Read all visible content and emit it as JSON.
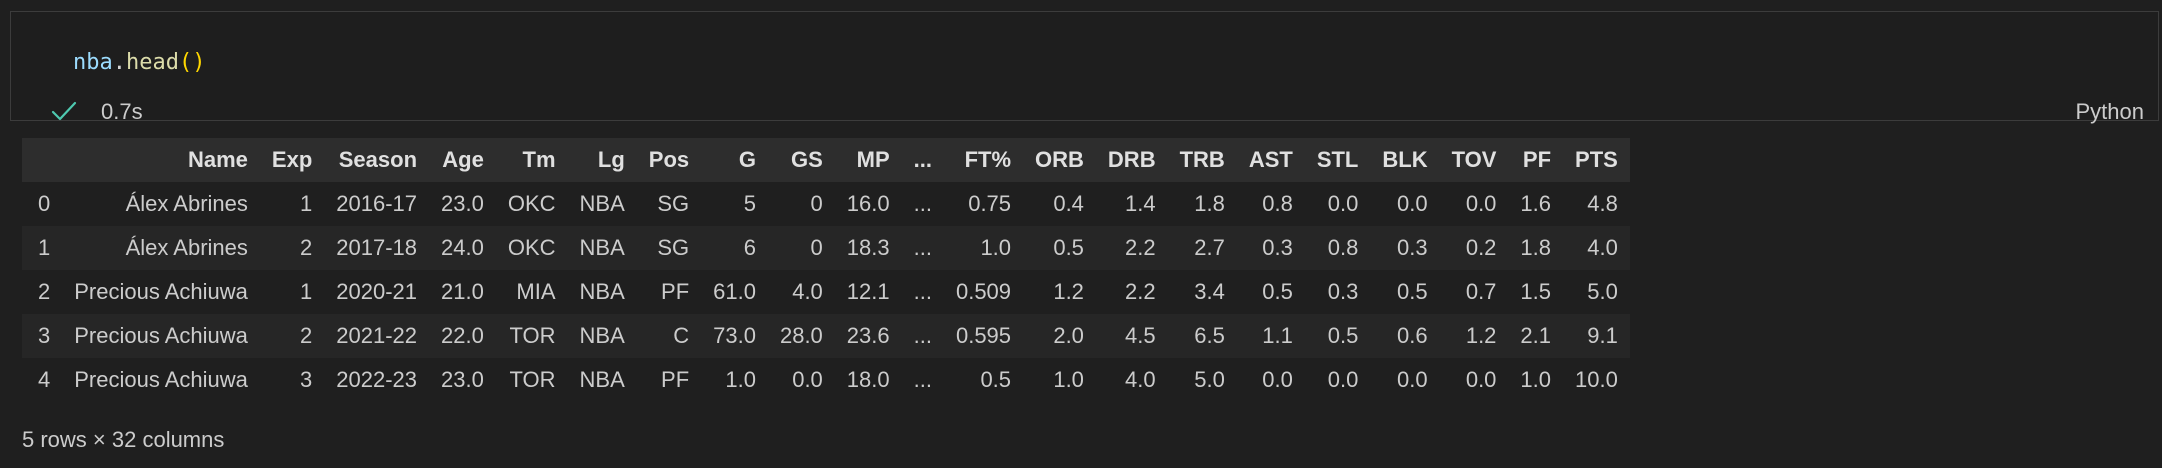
{
  "cell": {
    "code": {
      "var": "nba",
      "dot": ".",
      "fn": "head",
      "parens": "()"
    },
    "status_icon": "check-icon",
    "exec_time": "0.7s",
    "language": "Python"
  },
  "colors": {
    "background": "#1f1f1f",
    "success": "#4ec9b0",
    "variable": "#9cdcfe",
    "function": "#dcdcaa",
    "paren": "#ffd700"
  },
  "table": {
    "columns": [
      "",
      "Name",
      "Exp",
      "Season",
      "Age",
      "Tm",
      "Lg",
      "Pos",
      "G",
      "GS",
      "MP",
      "...",
      "FT%",
      "ORB",
      "DRB",
      "TRB",
      "AST",
      "STL",
      "BLK",
      "TOV",
      "PF",
      "PTS"
    ],
    "rows": [
      [
        "0",
        "Álex Abrines",
        "1",
        "2016-17",
        "23.0",
        "OKC",
        "NBA",
        "SG",
        "5",
        "0",
        "16.0",
        "...",
        "0.75",
        "0.4",
        "1.4",
        "1.8",
        "0.8",
        "0.0",
        "0.0",
        "0.0",
        "1.6",
        "4.8"
      ],
      [
        "1",
        "Álex Abrines",
        "2",
        "2017-18",
        "24.0",
        "OKC",
        "NBA",
        "SG",
        "6",
        "0",
        "18.3",
        "...",
        "1.0",
        "0.5",
        "2.2",
        "2.7",
        "0.3",
        "0.8",
        "0.3",
        "0.2",
        "1.8",
        "4.0"
      ],
      [
        "2",
        "Precious Achiuwa",
        "1",
        "2020-21",
        "21.0",
        "MIA",
        "NBA",
        "PF",
        "61.0",
        "4.0",
        "12.1",
        "...",
        "0.509",
        "1.2",
        "2.2",
        "3.4",
        "0.5",
        "0.3",
        "0.5",
        "0.7",
        "1.5",
        "5.0"
      ],
      [
        "3",
        "Precious Achiuwa",
        "2",
        "2021-22",
        "22.0",
        "TOR",
        "NBA",
        "C",
        "73.0",
        "28.0",
        "23.6",
        "...",
        "0.595",
        "2.0",
        "4.5",
        "6.5",
        "1.1",
        "0.5",
        "0.6",
        "1.2",
        "2.1",
        "9.1"
      ],
      [
        "4",
        "Precious Achiuwa",
        "3",
        "2022-23",
        "23.0",
        "TOR",
        "NBA",
        "PF",
        "1.0",
        "0.0",
        "18.0",
        "...",
        "0.5",
        "1.0",
        "4.0",
        "5.0",
        "0.0",
        "0.0",
        "0.0",
        "0.0",
        "1.0",
        "10.0"
      ]
    ]
  },
  "shape_text": "5 rows × 32 columns"
}
